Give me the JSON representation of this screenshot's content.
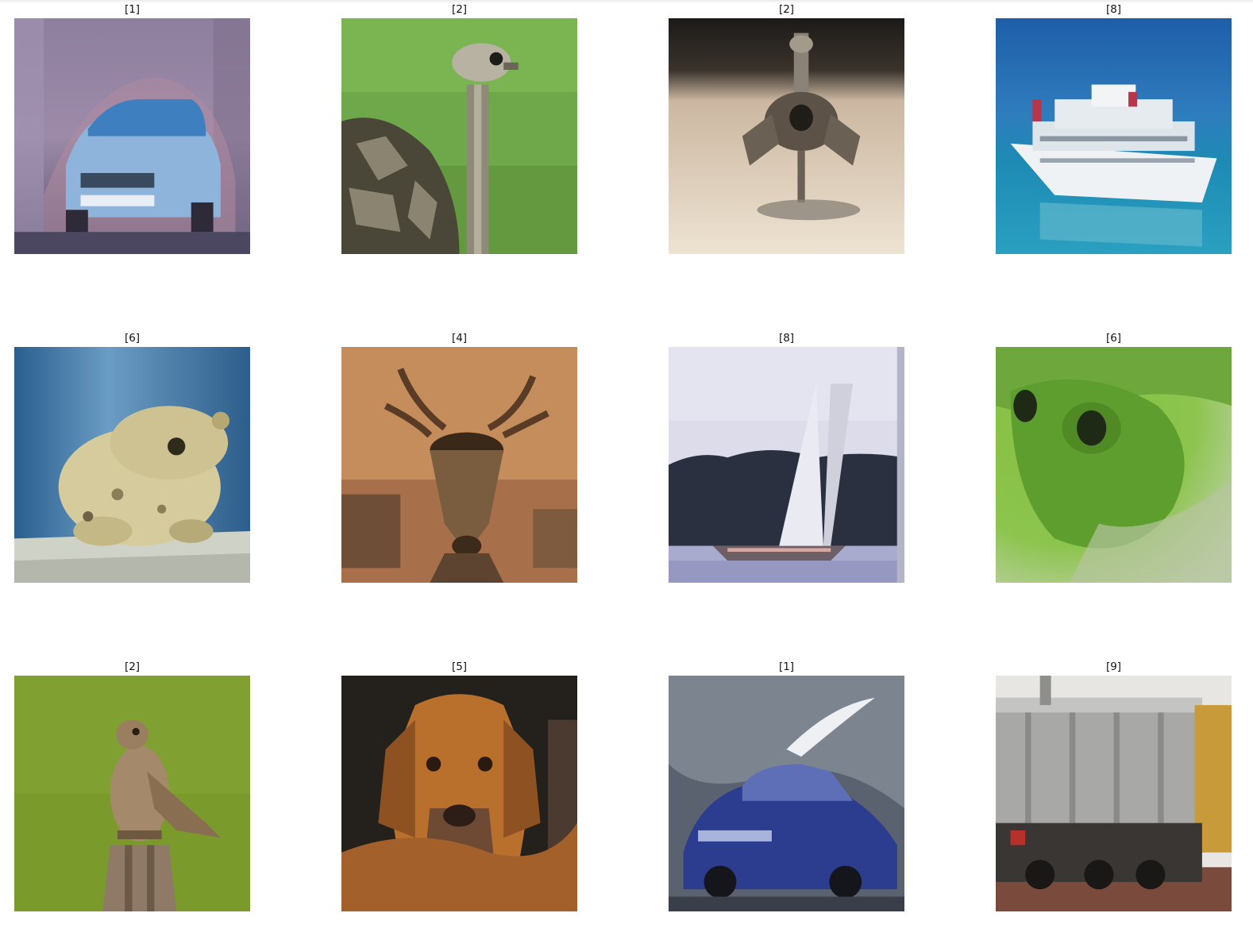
{
  "figure": {
    "images": [
      {
        "title": "[1]",
        "icon": "car-image"
      },
      {
        "title": "[2]",
        "icon": "ostrich-image"
      },
      {
        "title": "[2]",
        "icon": "bird-sand-image"
      },
      {
        "title": "[8]",
        "icon": "cruise-ship-image"
      },
      {
        "title": "[6]",
        "icon": "toad-image"
      },
      {
        "title": "[4]",
        "icon": "deer-image"
      },
      {
        "title": "[8]",
        "icon": "sailboat-image"
      },
      {
        "title": "[6]",
        "icon": "green-frog-image"
      },
      {
        "title": "[2]",
        "icon": "hawk-image"
      },
      {
        "title": "[5]",
        "icon": "dog-image"
      },
      {
        "title": "[1]",
        "icon": "blue-car-image"
      },
      {
        "title": "[9]",
        "icon": "truck-image"
      }
    ]
  }
}
